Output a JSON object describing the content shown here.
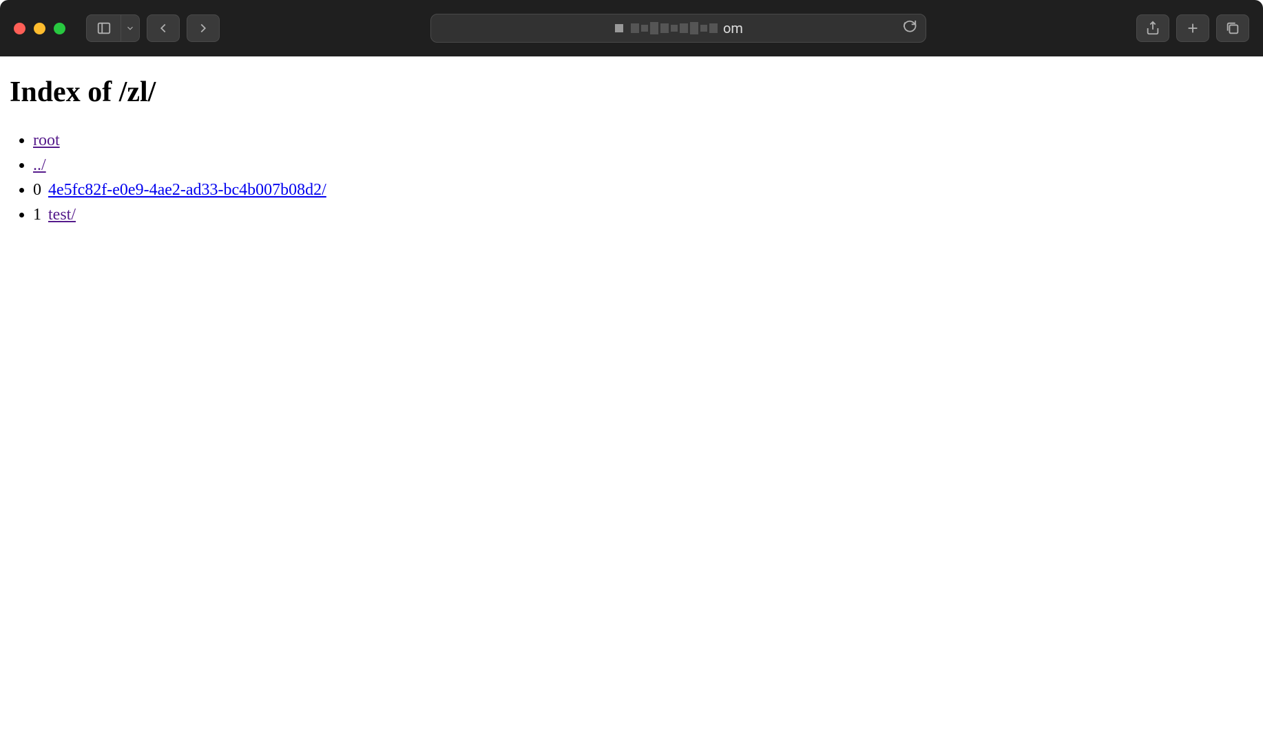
{
  "address_bar": {
    "visible_suffix": "om"
  },
  "page": {
    "heading": "Index of /zl/",
    "entries": [
      {
        "index": null,
        "label": "root",
        "visited": true
      },
      {
        "index": null,
        "label": "../",
        "visited": true
      },
      {
        "index": "0",
        "label": "4e5fc82f-e0e9-4ae2-ad33-bc4b007b08d2/",
        "visited": false
      },
      {
        "index": "1",
        "label": "test/",
        "visited": true
      }
    ]
  }
}
